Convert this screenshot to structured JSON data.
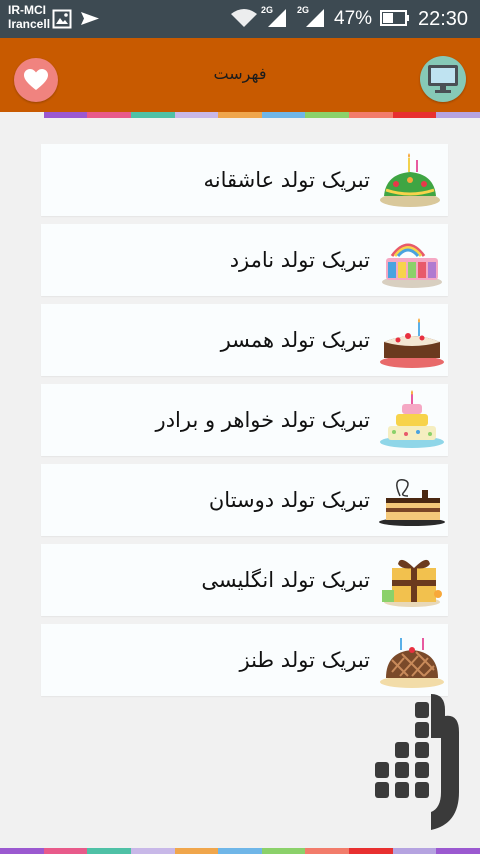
{
  "status_bar": {
    "carrier_1": "IR-MCI",
    "carrier_2": "Irancell",
    "network_1": "2G",
    "network_2": "2G",
    "battery": "47%",
    "time": "22:30"
  },
  "app_bar": {
    "title": "فهرست",
    "left_icon": "heart-icon",
    "right_icon": "monitor-icon"
  },
  "menu": {
    "items": [
      {
        "label": "تبریک تولد عاشقانه",
        "icon": "cake-icon"
      },
      {
        "label": "تبریک تولد نامزد",
        "icon": "cake-icon"
      },
      {
        "label": "تبریک تولد همسر",
        "icon": "cake-icon"
      },
      {
        "label": "تبریک تولد خواهر و برادر",
        "icon": "cake-icon"
      },
      {
        "label": "تبریک تولد دوستان",
        "icon": "cake-icon"
      },
      {
        "label": "تبریک تولد انگلیسی",
        "icon": "cake-icon"
      },
      {
        "label": "تبریک تولد طنز",
        "icon": "cake-icon"
      }
    ]
  },
  "colors": {
    "status_bar": "#3d4a52",
    "app_bar": "#c85a00",
    "background": "#f1f1f1",
    "card": "#fafdfe",
    "stripe": [
      "#9b59d0",
      "#e85a8a",
      "#4fc1a6",
      "#c8b8e8",
      "#f0a64c",
      "#6fb6e8",
      "#8bd16a",
      "#f27c6b",
      "#e83030",
      "#b5a3e0"
    ]
  }
}
